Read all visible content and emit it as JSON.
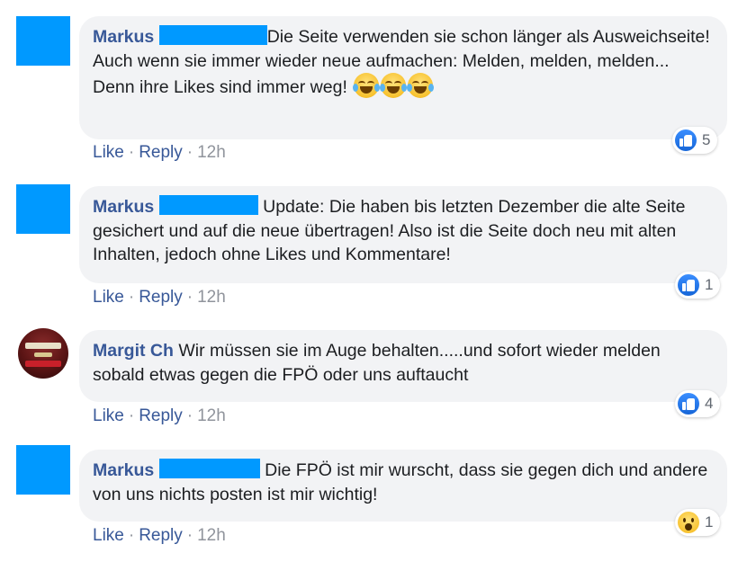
{
  "comments": [
    {
      "author": "Markus",
      "text": "Die Seite verwenden sie schon länger als Ausweichseite! Auch wenn sie immer wieder neue aufmachen: Melden, melden, melden...",
      "text2": "Denn ihre Likes sind immer weg!",
      "emoji": "laughing-crying-emoji",
      "actions": {
        "like": "Like",
        "reply": "Reply",
        "time": "12h",
        "sep": "·"
      },
      "reaction": {
        "type": "like-icon",
        "count": "5"
      }
    },
    {
      "author": "Markus",
      "text": "Update: Die haben bis letzten Dezember die alte Seite gesichert und auf die neue übertragen! Also ist die Seite doch neu mit alten Inhalten, jedoch ohne Likes und Kommentare!",
      "actions": {
        "like": "Like",
        "reply": "Reply",
        "time": "12h",
        "sep": "·"
      },
      "reaction": {
        "type": "like-icon",
        "count": "1"
      }
    },
    {
      "author": "Margit Ch",
      "text": "Wir müssen sie im Auge behalten.....und sofort wieder melden sobald etwas gegen die FPÖ oder uns auftaucht",
      "actions": {
        "like": "Like",
        "reply": "Reply",
        "time": "12h",
        "sep": "·"
      },
      "reaction": {
        "type": "like-icon",
        "count": "4"
      }
    },
    {
      "author": "Markus",
      "text": "Die FPÖ ist mir wurscht, dass sie gegen dich und andere von uns nichts posten ist mir wichtig!",
      "actions": {
        "like": "Like",
        "reply": "Reply",
        "time": "12h",
        "sep": "·"
      },
      "reaction": {
        "type": "wow-icon",
        "count": "1"
      }
    }
  ],
  "colors": {
    "name": "#385898",
    "bubble": "#f2f3f5",
    "redaction": "#0099ff",
    "like": "#1666d8"
  }
}
